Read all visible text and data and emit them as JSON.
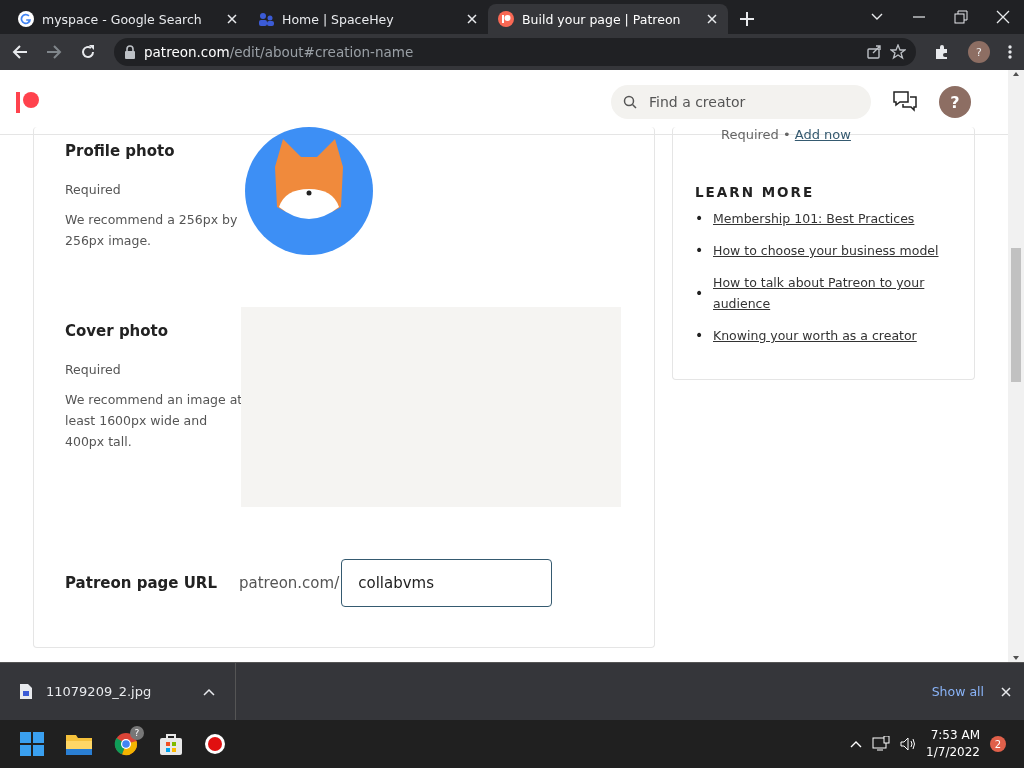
{
  "browser": {
    "tabs": [
      {
        "title": "myspace - Google Search",
        "selected": false
      },
      {
        "title": "Home | SpaceHey",
        "selected": false
      },
      {
        "title": "Build your page | Patreon",
        "selected": true
      }
    ],
    "address": {
      "host": "patreon.com",
      "path": "/edit/about#creation-name"
    },
    "profile": "?"
  },
  "header": {
    "search": {
      "placeholder": "Find a creator"
    },
    "avatar": "?"
  },
  "form": {
    "fields": [
      {
        "kind": "photo",
        "label": "Profile photo",
        "required": "Required",
        "hint": "We recommend a 256px by 256px image."
      },
      {
        "kind": "cover",
        "label": "Cover photo",
        "required": "Required",
        "hint": "We recommend an image at least 1600px wide and 400px tall."
      },
      {
        "kind": "url",
        "label": "Patreon page URL",
        "prefix": "patreon.com/",
        "value": "collabvms"
      }
    ]
  },
  "sidebar": {
    "status": {
      "text": "Required •",
      "link": "Add now"
    },
    "learn_more": {
      "title": "LEARN MORE",
      "links": [
        {
          "bullet": "•",
          "text": "Membership 101: Best Practices"
        },
        {
          "bullet": "•",
          "text": "How to choose your business model"
        },
        {
          "bullet": "•",
          "text": "How to talk about Patreon to your audience"
        },
        {
          "bullet": "•",
          "text": "Knowing your worth as a creator"
        }
      ]
    }
  },
  "download_bar": {
    "file": "11079209_2.jpg",
    "show_all": "Show all"
  },
  "taskbar": {
    "chrome_badge": "?",
    "time": "7:53 AM",
    "date": "1/7/2022",
    "notifications": "2"
  }
}
